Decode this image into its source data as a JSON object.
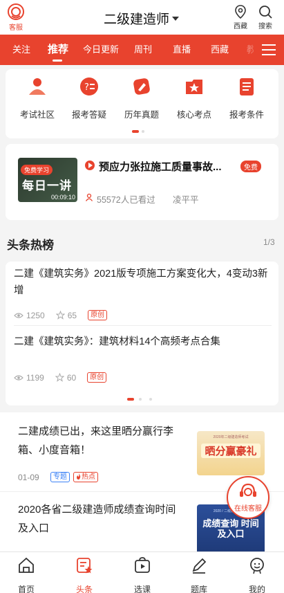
{
  "header": {
    "service_label": "客服",
    "title": "二级建造师",
    "region_label": "西藏",
    "search_label": "搜索"
  },
  "tabs": [
    "关注",
    "推荐",
    "今日更新",
    "周刊",
    "直播",
    "西藏",
    "教材"
  ],
  "active_tab": "推荐",
  "categories": [
    {
      "label": "考试社区",
      "icon": "community-icon"
    },
    {
      "label": "报考答疑",
      "icon": "qa-icon"
    },
    {
      "label": "历年真题",
      "icon": "exam-paper-icon"
    },
    {
      "label": "核心考点",
      "icon": "star-folder-icon"
    },
    {
      "label": "报考条件",
      "icon": "document-list-icon"
    }
  ],
  "featured": {
    "thumb_badge": "免费学习",
    "thumb_title": "每日一讲",
    "duration": "00:09:10",
    "title": "预应力张拉施工质量事故...",
    "free_tag": "免费",
    "views": "55572人已看过",
    "author": "凌平平"
  },
  "hot": {
    "title": "头条热榜",
    "page": "1/3",
    "items": [
      {
        "title": "二建《建筑实务》2021版专项施工方案变化大，4变动3新增",
        "views": "1250",
        "stars": "65",
        "tag": "原创"
      },
      {
        "title": "二建《建筑实务》：建筑材料14个高频考点合集",
        "views": "1199",
        "stars": "60",
        "tag": "原创"
      }
    ]
  },
  "articles": [
    {
      "title": "二建成绩已出，来这里晒分赢行李箱、小度音箱！",
      "date": "01-09",
      "tag1": "专题",
      "tag2": "热点",
      "img_small": "2020年二级建造师考试",
      "img_big": "晒分赢豪礼"
    },
    {
      "title": "2020各省二级建造师成绩查询时间及入口",
      "img_small": "2020 / 二级建造师考试",
      "img_big": "成绩查询 时间及入口"
    }
  ],
  "online_service": "在线客服",
  "bottom_nav": [
    {
      "label": "首页",
      "icon": "home-icon"
    },
    {
      "label": "头条",
      "icon": "headlines-icon"
    },
    {
      "label": "选课",
      "icon": "course-icon"
    },
    {
      "label": "题库",
      "icon": "question-bank-icon"
    },
    {
      "label": "我的",
      "icon": "profile-icon"
    }
  ],
  "colors": {
    "accent": "#e8432e",
    "tag_blue": "#3b82f6"
  }
}
